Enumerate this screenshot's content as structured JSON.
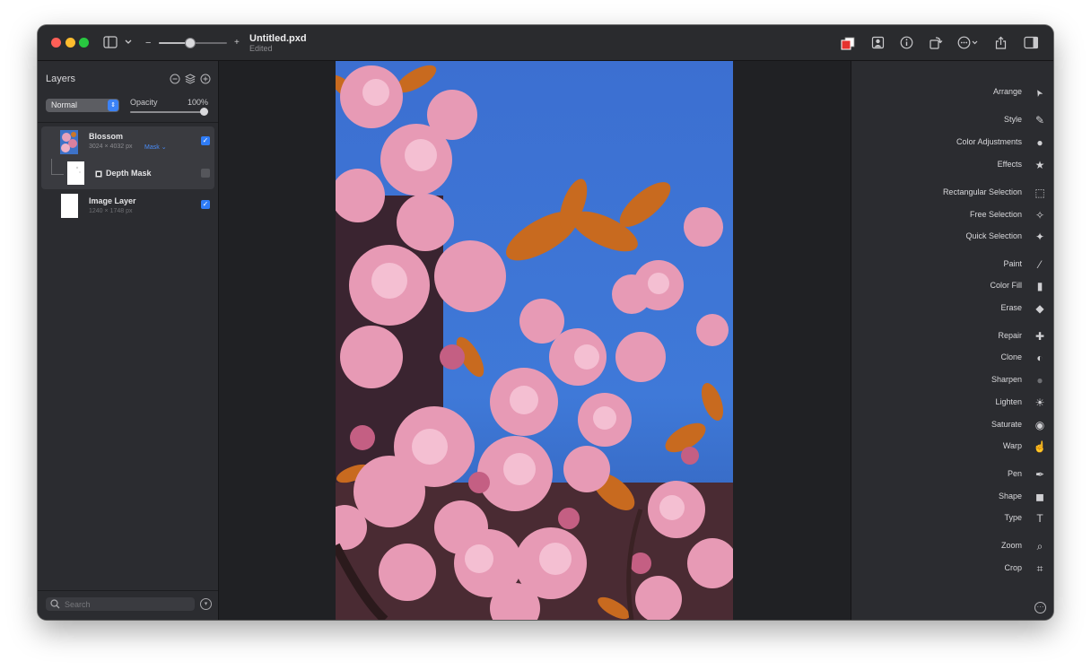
{
  "window": {
    "document_title": "Untitled.pxd",
    "document_status": "Edited"
  },
  "toolbar": {
    "zoom_level": 0.45,
    "zoom_out_symbol": "−",
    "zoom_in_symbol": "+",
    "icons": [
      "sidebar-toggle-icon",
      "chevron-down-icon",
      "color-swatch-icon",
      "portrait-icon",
      "info-icon",
      "rotate-icon",
      "more-options-icon",
      "share-icon",
      "inspector-toggle-icon"
    ]
  },
  "layers_panel": {
    "title": "Layers",
    "blend_mode": "Normal",
    "opacity_label": "Opacity",
    "opacity_value": "100%",
    "layers": [
      {
        "name": "Blossom",
        "meta": "3024 × 4032 px",
        "mask_label": "Mask",
        "visible": true,
        "selected": true
      },
      {
        "name": "Depth Mask",
        "meta": "",
        "visible": false,
        "selected": false
      },
      {
        "name": "Image Layer",
        "meta": "1240 × 1748 px",
        "visible": true,
        "selected": false
      }
    ],
    "search_placeholder": "Search"
  },
  "tools": [
    {
      "label": "Arrange",
      "icon": "arrow-cursor-icon"
    },
    {
      "label": "Style",
      "icon": "style-brush-icon"
    },
    {
      "label": "Color Adjustments",
      "icon": "color-adjustments-icon"
    },
    {
      "label": "Effects",
      "icon": "effects-star-icon"
    },
    {
      "label": "Rectangular Selection",
      "icon": "rectangular-selection-icon"
    },
    {
      "label": "Free Selection",
      "icon": "free-selection-icon"
    },
    {
      "label": "Quick Selection",
      "icon": "quick-selection-icon"
    },
    {
      "label": "Paint",
      "icon": "paint-brush-icon"
    },
    {
      "label": "Color Fill",
      "icon": "color-fill-icon"
    },
    {
      "label": "Erase",
      "icon": "eraser-icon"
    },
    {
      "label": "Repair",
      "icon": "repair-bandage-icon"
    },
    {
      "label": "Clone",
      "icon": "clone-stamp-icon"
    },
    {
      "label": "Sharpen",
      "icon": "sharpen-icon"
    },
    {
      "label": "Lighten",
      "icon": "lighten-sun-icon"
    },
    {
      "label": "Saturate",
      "icon": "saturate-sponge-icon"
    },
    {
      "label": "Warp",
      "icon": "warp-finger-icon"
    },
    {
      "label": "Pen",
      "icon": "pen-nib-icon"
    },
    {
      "label": "Shape",
      "icon": "shape-icon"
    },
    {
      "label": "Type",
      "icon": "type-t-icon"
    },
    {
      "label": "Zoom",
      "icon": "magnifier-icon"
    },
    {
      "label": "Crop",
      "icon": "crop-icon"
    }
  ],
  "colors": {
    "accent": "#2f7cf6",
    "window_bg": "#202124",
    "panel_bg": "#2b2c30"
  }
}
